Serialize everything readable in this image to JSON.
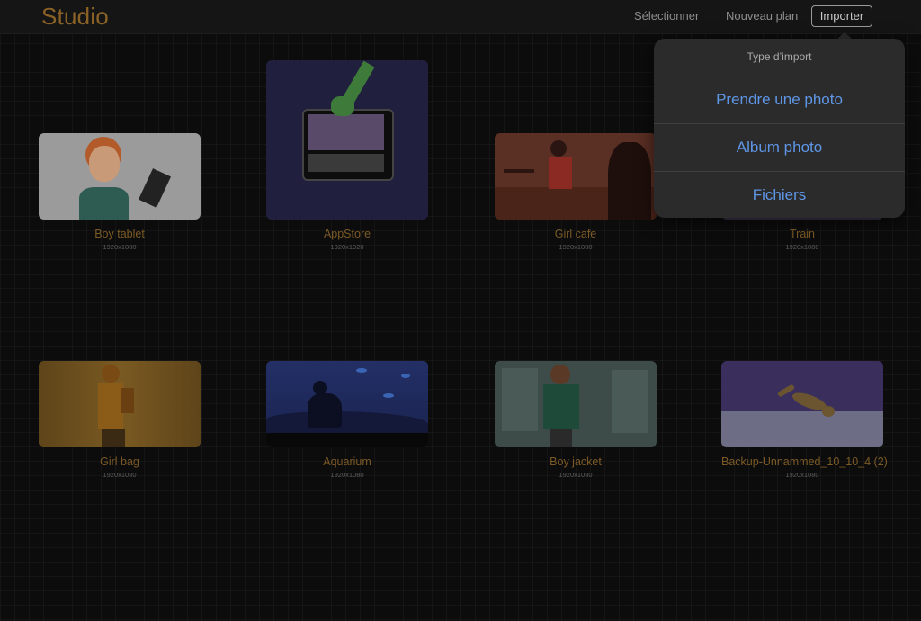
{
  "header": {
    "title": "Studio",
    "select_label": "Sélectionner",
    "new_plan_label": "Nouveau plan",
    "import_label": "Importer"
  },
  "import_popover": {
    "title": "Type d’import",
    "items": [
      {
        "label": "Prendre une photo"
      },
      {
        "label": "Album photo"
      },
      {
        "label": "Fichiers"
      }
    ]
  },
  "projects": [
    {
      "name": "Boy tablet",
      "dims": "1920x1080"
    },
    {
      "name": "AppStore",
      "dims": "1920x1920"
    },
    {
      "name": "Girl cafe",
      "dims": "1920x1080"
    },
    {
      "name": "Train",
      "dims": "1920x1080"
    },
    {
      "name": "Girl bag",
      "dims": "1920x1080"
    },
    {
      "name": "Aquarium",
      "dims": "1920x1080"
    },
    {
      "name": "Boy jacket",
      "dims": "1920x1080"
    },
    {
      "name": "Backup-Unnammed_10_10_4 (2)",
      "dims": "1920x1080"
    }
  ],
  "colors": {
    "accent": "#8a6226",
    "popover_action": "#5e96e6"
  }
}
